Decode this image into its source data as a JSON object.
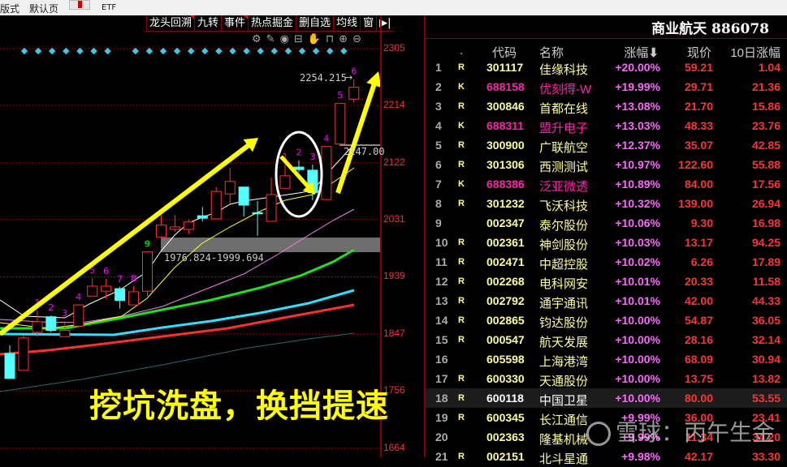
{
  "topbar": {
    "items": [
      "版式",
      "默认页",
      "ETF"
    ]
  },
  "toolbar": {
    "items": [
      "龙头回溯",
      "九转",
      "事件",
      "热点掘金",
      "删自选",
      "均线",
      "窗"
    ]
  },
  "tools": [
    "gear",
    "pen",
    "eye",
    "briefcase",
    "hand",
    "lock",
    "zoom-in",
    "zoom-out"
  ],
  "yaxis": [
    "2305",
    "2214",
    "2122",
    "2031",
    "1939",
    "1847",
    "1756",
    "1664"
  ],
  "chart_data": {
    "type": "candlestick",
    "ylim": [
      1664,
      2305
    ],
    "candles": [
      [
        1816,
        1776,
        1829,
        1776
      ],
      [
        1789,
        1841,
        1845,
        1789
      ],
      [
        1850,
        1867,
        1885,
        1843
      ],
      [
        1875,
        1853,
        1877,
        1850
      ],
      [
        1843,
        1853,
        1868,
        1843
      ],
      [
        1860,
        1894,
        1894,
        1860
      ],
      [
        1908,
        1924,
        1937,
        1908
      ],
      [
        1916,
        1924,
        1936,
        1903
      ],
      [
        1920,
        1901,
        1923,
        1888
      ],
      [
        1894,
        1915,
        1924,
        1894
      ],
      [
        1916,
        1979,
        1979,
        1908
      ],
      [
        2003,
        2022,
        2038,
        2003
      ],
      [
        2015,
        2019,
        2038,
        2011
      ],
      [
        2015,
        2027,
        2031,
        2007
      ],
      [
        2037,
        2033,
        2051,
        2028
      ],
      [
        2032,
        2076,
        2083,
        2032
      ],
      [
        2072,
        2092,
        2114,
        2055
      ],
      [
        2083,
        2054,
        2083,
        2036
      ],
      [
        2042,
        2041,
        2061,
        2005
      ],
      [
        2028,
        2071,
        2098,
        2028
      ],
      [
        2081,
        2101,
        2119,
        2081
      ],
      [
        2115,
        2111,
        2126,
        2107
      ],
      [
        2110,
        2074,
        2119,
        2062
      ],
      [
        2063,
        2148,
        2148,
        2063
      ],
      [
        2152,
        2217,
        2218,
        2152
      ],
      [
        2224,
        2243,
        2256,
        2218
      ]
    ],
    "counts": [
      {
        "i": 2,
        "t": "1"
      },
      {
        "i": 3,
        "t": "2"
      },
      {
        "i": 4,
        "t": "3"
      },
      {
        "i": 5,
        "t": "4"
      },
      {
        "i": 6,
        "t": "5"
      },
      {
        "i": 7,
        "t": "6"
      },
      {
        "i": 8,
        "t": "7"
      },
      {
        "i": 9,
        "t": "8"
      },
      {
        "i": 10,
        "t": "9",
        "c": "#0c0"
      },
      {
        "i": 20,
        "t": "1"
      },
      {
        "i": 21,
        "t": "2"
      },
      {
        "i": 22,
        "t": "3"
      },
      {
        "i": 23,
        "t": "4"
      },
      {
        "i": 24,
        "t": "5"
      },
      {
        "i": 25,
        "t": "6"
      }
    ],
    "high_label": "2254.215",
    "gap_label": "1976.824-1999.694",
    "last_label": "2147.00"
  },
  "annotation": "挖坑洗盘，换挡提速",
  "watermark": "雪球：丙午生金",
  "panel": {
    "title": "商业航天 886078",
    "headers": [
      ".",
      "代码",
      "名称",
      "涨幅",
      "现价",
      "10日涨幅"
    ],
    "rows": [
      [
        "1",
        "R",
        "301117",
        "佳缘科技",
        "+20.00%",
        "59.21",
        "1.04"
      ],
      [
        "2",
        "K",
        "688158",
        "优刻得-W",
        "+19.99%",
        "29.71",
        "21.36"
      ],
      [
        "3",
        "R",
        "300846",
        "首都在线",
        "+13.08%",
        "21.70",
        "15.86"
      ],
      [
        "4",
        "K",
        "688311",
        "盟升电子",
        "+13.03%",
        "48.33",
        "23.76"
      ],
      [
        "5",
        "R",
        "300900",
        "广联航空",
        "+12.37%",
        "35.07",
        "42.85"
      ],
      [
        "6",
        "R",
        "301306",
        "西测测试",
        "+10.97%",
        "122.60",
        "55.88"
      ],
      [
        "7",
        "K",
        "688386",
        "泛亚微透",
        "+10.89%",
        "84.00",
        "17.56"
      ],
      [
        "8",
        "R",
        "301232",
        "飞沃科技",
        "+10.32%",
        "139.00",
        "26.94"
      ],
      [
        "9",
        "",
        "002347",
        "泰尔股份",
        "+10.06%",
        "9.30",
        "16.98"
      ],
      [
        "10",
        "R",
        "002361",
        "神剑股份",
        "+10.03%",
        "13.17",
        "94.25"
      ],
      [
        "11",
        "R",
        "002471",
        "中超控股",
        "+10.02%",
        "6.26",
        "17.89"
      ],
      [
        "12",
        "R",
        "002268",
        "电科网安",
        "+10.01%",
        "20.33",
        "11.58"
      ],
      [
        "13",
        "R",
        "002792",
        "通宇通讯",
        "+10.01%",
        "42.00",
        "44.33"
      ],
      [
        "14",
        "R",
        "002865",
        "钧达股份",
        "+10.00%",
        "54.87",
        "36.05"
      ],
      [
        "15",
        "R",
        "000547",
        "航天发展",
        "+10.00%",
        "28.16",
        "32.14"
      ],
      [
        "16",
        "",
        "605598",
        "上海港湾",
        "+10.00%",
        "68.09",
        "30.94"
      ],
      [
        "17",
        "R",
        "600330",
        "天通股份",
        "+10.00%",
        "13.75",
        "13.82"
      ],
      [
        "18",
        "R",
        "600118",
        "中国卫星",
        "+10.00%",
        "80.00",
        "53.55"
      ],
      [
        "19",
        "R",
        "600345",
        "长江通信",
        "+9.99%",
        "36.00",
        "23.41"
      ],
      [
        "20",
        "",
        "002363",
        "隆基机械",
        "+9.99%",
        "11.34",
        "34.20"
      ],
      [
        "21",
        "R",
        "002151",
        "北斗星通",
        "+9.98%",
        "42.17",
        "33.30"
      ]
    ],
    "selected": 18
  }
}
